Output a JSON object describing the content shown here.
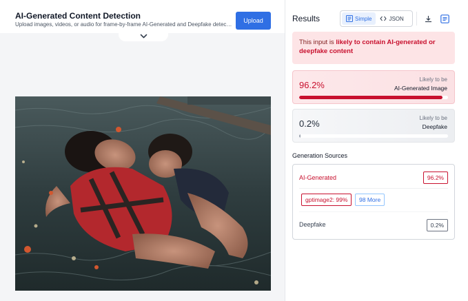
{
  "app": {
    "title": "AI-Generated Content Detection",
    "subtitle": "Upload images, videos, or audio for frame-by-frame AI-Generated and Deepfake detection with...",
    "upload_label": "Upload"
  },
  "results": {
    "title": "Results",
    "view_modes": [
      {
        "label": "Simple",
        "icon": "list-icon",
        "active": true
      },
      {
        "label": "JSON",
        "icon": "code-icon",
        "active": false
      }
    ],
    "toolbar_icons": [
      "download-icon",
      "report-icon"
    ],
    "verdict": {
      "prefix": "This input is ",
      "emphasis": "likely to contain AI-generated or deepfake content"
    },
    "scores": [
      {
        "percent": "96.2%",
        "value": 0.962,
        "label_line1": "Likely to be",
        "label_line2": "AI-Generated Image",
        "color": "#c8102e"
      },
      {
        "percent": "0.2%",
        "value": 0.002,
        "label_line1": "Likely to be",
        "label_line2": "Deepfake",
        "color": "#9ca3af"
      }
    ]
  },
  "generation_sources": {
    "title": "Generation Sources",
    "ai": {
      "label": "AI-Generated",
      "percent": "96.2%"
    },
    "chips": {
      "model": "gptimage2: 99%",
      "more": "98 More"
    },
    "deepfake": {
      "label": "Deepfake",
      "percent": "0.2%"
    }
  },
  "colors": {
    "accent": "#2f6fe4",
    "danger": "#c8102e",
    "verdict_bg": "#fde4e6"
  }
}
